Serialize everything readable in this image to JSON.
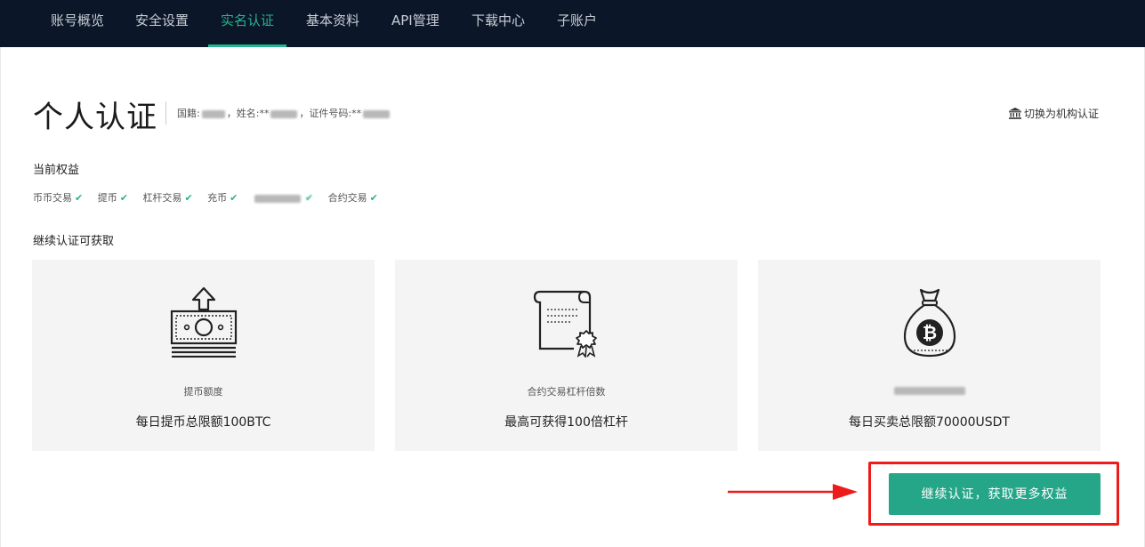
{
  "nav": {
    "tabs": [
      {
        "label": "账号概览"
      },
      {
        "label": "安全设置"
      },
      {
        "label": "实名认证"
      },
      {
        "label": "基本资料"
      },
      {
        "label": "API管理"
      },
      {
        "label": "下载中心"
      },
      {
        "label": "子账户"
      }
    ],
    "active_index": 2
  },
  "header": {
    "title": "个人认证",
    "nationality_label": "国籍:",
    "name_label": "姓名:",
    "name_stars": "**",
    "id_label": "证件号码:",
    "id_stars": "**",
    "switch_link": "切换为机构认证",
    "switch_icon": "bank-building-icon"
  },
  "current": {
    "label": "当前权益",
    "items": [
      {
        "label": "币币交易"
      },
      {
        "label": "提币"
      },
      {
        "label": "杠杆交易"
      },
      {
        "label": "充币"
      },
      {
        "label": ""
      },
      {
        "label": "合约交易"
      }
    ],
    "check_icon": "check-icon"
  },
  "more": {
    "label": "继续认证可获取",
    "cards": [
      {
        "icon": "withdraw-money-icon",
        "sub": "提币额度",
        "main": "每日提币总限额100BTC"
      },
      {
        "icon": "contract-certificate-icon",
        "sub": "合约交易杠杆倍数",
        "main": "最高可获得100倍杠杆"
      },
      {
        "icon": "bitcoin-bag-icon",
        "sub": "",
        "main": "每日买卖总限额70000USDT"
      }
    ]
  },
  "cta": {
    "label": "继续认证，获取更多权益"
  },
  "colors": {
    "accent": "#26b38f",
    "nav_bg": "#0b1628",
    "highlight": "#ee1b1b"
  }
}
